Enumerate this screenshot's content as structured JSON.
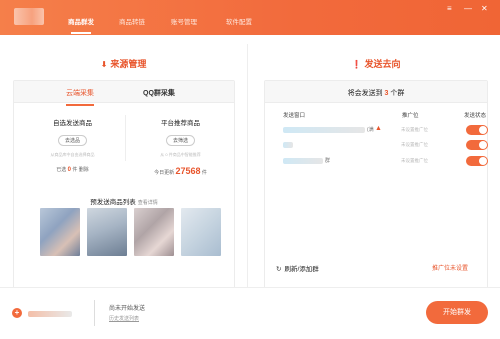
{
  "top_nav": {
    "items": [
      {
        "label": "商品群发"
      },
      {
        "label": "商品转链"
      },
      {
        "label": "账号管理"
      },
      {
        "label": "软件配置"
      }
    ],
    "window_controls": [
      "≡",
      "—",
      "✕"
    ]
  },
  "source": {
    "title": "来源管理",
    "icon": "down-arrow-icon",
    "tabs": [
      {
        "label": "云端采集"
      },
      {
        "label": "QQ群采集"
      }
    ],
    "custom": {
      "title": "自选发送商品",
      "button": "去选品",
      "desc": "从商品库中自由选择商品",
      "stat_prefix": "已选",
      "stat_value": "0",
      "stat_unit": "件",
      "stat_extra": "删除"
    },
    "platform": {
      "title": "平台推荐商品",
      "button": "去筛选",
      "desc": "从 0 件商品中智能推荐",
      "stat_prefix": "今日更新",
      "stat_value": "27568",
      "stat_unit": "件"
    },
    "preview": {
      "title": "预发送商品列表",
      "link": "查看详情"
    }
  },
  "destination": {
    "title": "发送去向",
    "icon": "exclamation-icon",
    "summary_prefix": "将会发送到",
    "summary_count": "3",
    "summary_suffix": "个群",
    "columns": [
      "发送窗口",
      "推广位",
      "发送状态"
    ],
    "rows": [
      {
        "tail": "(满",
        "promo": "未设置推广位",
        "enabled": true,
        "warning": true
      },
      {
        "tail": "",
        "promo": "未设置推广位",
        "enabled": true,
        "warning": false
      },
      {
        "tail": "群",
        "promo": "未设置推广位",
        "enabled": true,
        "warning": false
      }
    ],
    "refresh": "刷新/添加群",
    "unset": "推广位未设置"
  },
  "footer": {
    "status": "尚未开始发送",
    "history": "历史发送列表",
    "start": "开始群发"
  },
  "colors": {
    "accent": "#f26a3c",
    "header_start": "#f57f4a",
    "header_end": "#f06535"
  }
}
